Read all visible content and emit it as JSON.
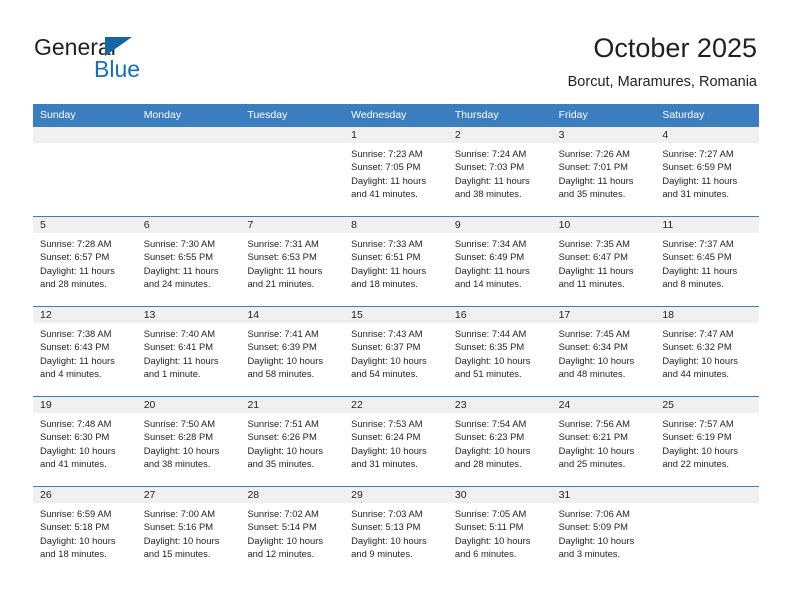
{
  "brand": {
    "word1": "General",
    "word2": "Blue",
    "accent_color": "#1570bb",
    "triangle_color": "#1565a8"
  },
  "header": {
    "title": "October 2025",
    "subtitle": "Borcut, Maramures, Romania"
  },
  "theme": {
    "header_blue": "#3a7ebf",
    "day_head_gray": "#f0f0f0",
    "text_color": "#231f20"
  },
  "labels": {
    "sunrise_prefix": "Sunrise:",
    "sunset_prefix": "Sunset:",
    "daylight_prefix": "Daylight:"
  },
  "weekdays": [
    "Sunday",
    "Monday",
    "Tuesday",
    "Wednesday",
    "Thursday",
    "Friday",
    "Saturday"
  ],
  "weeks": [
    [
      {
        "date": "",
        "l1": "",
        "l2": "",
        "l3": "",
        "l4": ""
      },
      {
        "date": "",
        "l1": "",
        "l2": "",
        "l3": "",
        "l4": ""
      },
      {
        "date": "",
        "l1": "",
        "l2": "",
        "l3": "",
        "l4": ""
      },
      {
        "date": "1",
        "l1": "Sunrise: 7:23 AM",
        "l2": "Sunset: 7:05 PM",
        "l3": "Daylight: 11 hours",
        "l4": "and 41 minutes."
      },
      {
        "date": "2",
        "l1": "Sunrise: 7:24 AM",
        "l2": "Sunset: 7:03 PM",
        "l3": "Daylight: 11 hours",
        "l4": "and 38 minutes."
      },
      {
        "date": "3",
        "l1": "Sunrise: 7:26 AM",
        "l2": "Sunset: 7:01 PM",
        "l3": "Daylight: 11 hours",
        "l4": "and 35 minutes."
      },
      {
        "date": "4",
        "l1": "Sunrise: 7:27 AM",
        "l2": "Sunset: 6:59 PM",
        "l3": "Daylight: 11 hours",
        "l4": "and 31 minutes."
      }
    ],
    [
      {
        "date": "5",
        "l1": "Sunrise: 7:28 AM",
        "l2": "Sunset: 6:57 PM",
        "l3": "Daylight: 11 hours",
        "l4": "and 28 minutes."
      },
      {
        "date": "6",
        "l1": "Sunrise: 7:30 AM",
        "l2": "Sunset: 6:55 PM",
        "l3": "Daylight: 11 hours",
        "l4": "and 24 minutes."
      },
      {
        "date": "7",
        "l1": "Sunrise: 7:31 AM",
        "l2": "Sunset: 6:53 PM",
        "l3": "Daylight: 11 hours",
        "l4": "and 21 minutes."
      },
      {
        "date": "8",
        "l1": "Sunrise: 7:33 AM",
        "l2": "Sunset: 6:51 PM",
        "l3": "Daylight: 11 hours",
        "l4": "and 18 minutes."
      },
      {
        "date": "9",
        "l1": "Sunrise: 7:34 AM",
        "l2": "Sunset: 6:49 PM",
        "l3": "Daylight: 11 hours",
        "l4": "and 14 minutes."
      },
      {
        "date": "10",
        "l1": "Sunrise: 7:35 AM",
        "l2": "Sunset: 6:47 PM",
        "l3": "Daylight: 11 hours",
        "l4": "and 11 minutes."
      },
      {
        "date": "11",
        "l1": "Sunrise: 7:37 AM",
        "l2": "Sunset: 6:45 PM",
        "l3": "Daylight: 11 hours",
        "l4": "and 8 minutes."
      }
    ],
    [
      {
        "date": "12",
        "l1": "Sunrise: 7:38 AM",
        "l2": "Sunset: 6:43 PM",
        "l3": "Daylight: 11 hours",
        "l4": "and 4 minutes."
      },
      {
        "date": "13",
        "l1": "Sunrise: 7:40 AM",
        "l2": "Sunset: 6:41 PM",
        "l3": "Daylight: 11 hours",
        "l4": "and 1 minute."
      },
      {
        "date": "14",
        "l1": "Sunrise: 7:41 AM",
        "l2": "Sunset: 6:39 PM",
        "l3": "Daylight: 10 hours",
        "l4": "and 58 minutes."
      },
      {
        "date": "15",
        "l1": "Sunrise: 7:43 AM",
        "l2": "Sunset: 6:37 PM",
        "l3": "Daylight: 10 hours",
        "l4": "and 54 minutes."
      },
      {
        "date": "16",
        "l1": "Sunrise: 7:44 AM",
        "l2": "Sunset: 6:35 PM",
        "l3": "Daylight: 10 hours",
        "l4": "and 51 minutes."
      },
      {
        "date": "17",
        "l1": "Sunrise: 7:45 AM",
        "l2": "Sunset: 6:34 PM",
        "l3": "Daylight: 10 hours",
        "l4": "and 48 minutes."
      },
      {
        "date": "18",
        "l1": "Sunrise: 7:47 AM",
        "l2": "Sunset: 6:32 PM",
        "l3": "Daylight: 10 hours",
        "l4": "and 44 minutes."
      }
    ],
    [
      {
        "date": "19",
        "l1": "Sunrise: 7:48 AM",
        "l2": "Sunset: 6:30 PM",
        "l3": "Daylight: 10 hours",
        "l4": "and 41 minutes."
      },
      {
        "date": "20",
        "l1": "Sunrise: 7:50 AM",
        "l2": "Sunset: 6:28 PM",
        "l3": "Daylight: 10 hours",
        "l4": "and 38 minutes."
      },
      {
        "date": "21",
        "l1": "Sunrise: 7:51 AM",
        "l2": "Sunset: 6:26 PM",
        "l3": "Daylight: 10 hours",
        "l4": "and 35 minutes."
      },
      {
        "date": "22",
        "l1": "Sunrise: 7:53 AM",
        "l2": "Sunset: 6:24 PM",
        "l3": "Daylight: 10 hours",
        "l4": "and 31 minutes."
      },
      {
        "date": "23",
        "l1": "Sunrise: 7:54 AM",
        "l2": "Sunset: 6:23 PM",
        "l3": "Daylight: 10 hours",
        "l4": "and 28 minutes."
      },
      {
        "date": "24",
        "l1": "Sunrise: 7:56 AM",
        "l2": "Sunset: 6:21 PM",
        "l3": "Daylight: 10 hours",
        "l4": "and 25 minutes."
      },
      {
        "date": "25",
        "l1": "Sunrise: 7:57 AM",
        "l2": "Sunset: 6:19 PM",
        "l3": "Daylight: 10 hours",
        "l4": "and 22 minutes."
      }
    ],
    [
      {
        "date": "26",
        "l1": "Sunrise: 6:59 AM",
        "l2": "Sunset: 5:18 PM",
        "l3": "Daylight: 10 hours",
        "l4": "and 18 minutes."
      },
      {
        "date": "27",
        "l1": "Sunrise: 7:00 AM",
        "l2": "Sunset: 5:16 PM",
        "l3": "Daylight: 10 hours",
        "l4": "and 15 minutes."
      },
      {
        "date": "28",
        "l1": "Sunrise: 7:02 AM",
        "l2": "Sunset: 5:14 PM",
        "l3": "Daylight: 10 hours",
        "l4": "and 12 minutes."
      },
      {
        "date": "29",
        "l1": "Sunrise: 7:03 AM",
        "l2": "Sunset: 5:13 PM",
        "l3": "Daylight: 10 hours",
        "l4": "and 9 minutes."
      },
      {
        "date": "30",
        "l1": "Sunrise: 7:05 AM",
        "l2": "Sunset: 5:11 PM",
        "l3": "Daylight: 10 hours",
        "l4": "and 6 minutes."
      },
      {
        "date": "31",
        "l1": "Sunrise: 7:06 AM",
        "l2": "Sunset: 5:09 PM",
        "l3": "Daylight: 10 hours",
        "l4": "and 3 minutes."
      },
      {
        "date": "",
        "l1": "",
        "l2": "",
        "l3": "",
        "l4": ""
      }
    ]
  ]
}
